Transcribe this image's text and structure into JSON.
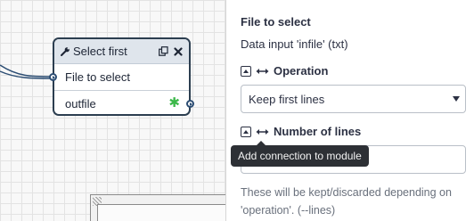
{
  "node": {
    "title": "Select first",
    "input_label": "File to select",
    "output_label": "outfile"
  },
  "panel": {
    "param_title": "File to select",
    "param_desc": "Data input 'infile' (txt)",
    "operation": {
      "label": "Operation",
      "selected": "Keep first lines"
    },
    "number_of_lines": {
      "label": "Number of lines",
      "value": ""
    },
    "tooltip": "Add connection to module",
    "help": "These will be kept/discarded depending on 'operation'. (--lines)"
  },
  "icons": {
    "node_header": [
      "wrench-icon",
      "clone-icon",
      "close-icon"
    ],
    "section": [
      "collapse-icon",
      "arrows-horizontal-icon"
    ]
  },
  "colors": {
    "node_border": "#2c3e50",
    "node_header_bg": "#dfe5ec",
    "asterisk": "#3cb84a",
    "tooltip_bg": "#2d3035"
  }
}
